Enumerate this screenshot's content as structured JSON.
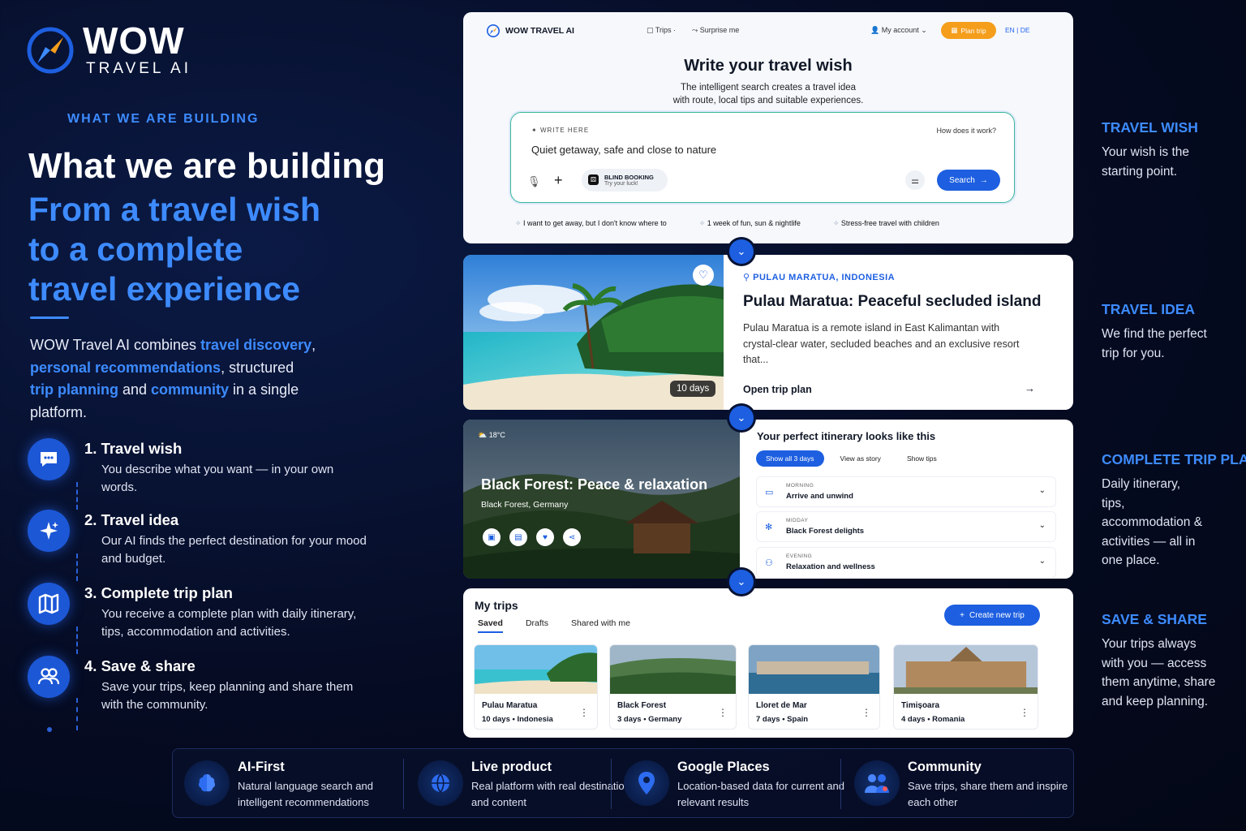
{
  "brand": {
    "name": "WOW",
    "tagline": "TRAVEL AI"
  },
  "left": {
    "eyebrow": "WHAT WE ARE BUILDING",
    "heading": "What we are building",
    "subheading_lines": [
      "From a travel wish",
      "to a complete",
      "travel experience"
    ],
    "intro": {
      "p1": "WOW Travel AI combines ",
      "k1": "travel discovery",
      "p2": ",",
      "k2": "personal recommendations",
      "p3": ", structured",
      "k3": "trip planning",
      "p4": " and ",
      "k4": "community",
      "p5": " in a single platform."
    },
    "steps": [
      {
        "title": "1.  Travel wish",
        "desc": "You describe what you want — in your own words.",
        "icon": "chat-icon"
      },
      {
        "title": "2.  Travel idea",
        "desc": "Our AI finds the perfect destination for your mood and budget.",
        "icon": "sparkle-icon"
      },
      {
        "title": "3.  Complete trip plan",
        "desc": "You receive a complete plan with daily itinerary, tips, accommodation and activities.",
        "icon": "map-icon"
      },
      {
        "title": "4.  Save & share",
        "desc": "Save your trips, keep planning and share them with the community.",
        "icon": "people-icon"
      }
    ]
  },
  "side": [
    {
      "title": "TRAVEL WISH",
      "desc": "Your wish is the starting point."
    },
    {
      "title": "TRAVEL IDEA",
      "desc": "We find the perfect trip for you."
    },
    {
      "title": "COMPLETE TRIP PLAN",
      "desc": "Daily itinerary, tips, accommodation & activities — all in one place."
    },
    {
      "title": "SAVE & SHARE",
      "desc": "Your trips always with you — access them anytime, share and keep planning."
    }
  ],
  "search_card": {
    "nav": {
      "brand": "WOW TRAVEL AI",
      "trips": "Trips",
      "surprise": "Surprise me",
      "account": "My account",
      "plan": "Plan trip",
      "lang": "EN  |  DE"
    },
    "title": "Write your travel wish",
    "subtitle_1": "The intelligent search creates a travel idea",
    "subtitle_2": "with route, local tips and suitable experiences.",
    "label": "WRITE HERE",
    "how": "How does it work?",
    "query": "Quiet getaway, safe and close to nature",
    "blind_title": "BLIND BOOKING",
    "blind_sub": "Try your luck!",
    "search_label": "Search",
    "chips": [
      "I want to get away, but I don't know where to",
      "1 week of fun, sun & nightlife",
      "Stress-free travel with children"
    ]
  },
  "idea_card": {
    "location": "PULAU MARATUA, INDONESIA",
    "title": "Pulau Maratua: Peaceful secluded island",
    "desc": "Pulau Maratua is a remote island in East Kalimantan with crystal-clear water, secluded beaches and an exclusive resort that...",
    "days": "10 days",
    "open": "Open trip plan"
  },
  "plan_card": {
    "temp": "18°C",
    "title": "Black Forest: Peace & relaxation",
    "subtitle": "Black Forest, Germany",
    "heading": "Your perfect itinerary looks like this",
    "tabs": [
      "Show all 3 days",
      "View as story",
      "Show tips"
    ],
    "slots": [
      {
        "time": "MORNING",
        "title": "Arrive and unwind"
      },
      {
        "time": "MIDDAY",
        "title": "Black Forest delights"
      },
      {
        "time": "EVENING",
        "title": "Relaxation and wellness"
      }
    ]
  },
  "trips_card": {
    "title": "My trips",
    "tabs": [
      "Saved",
      "Drafts",
      "Shared with me"
    ],
    "create": "Create new trip",
    "trips": [
      {
        "name": "Pulau Maratua",
        "meta": "10 days • Indonesia"
      },
      {
        "name": "Black Forest",
        "meta": "3 days • Germany"
      },
      {
        "name": "Lloret de Mar",
        "meta": "7 days • Spain"
      },
      {
        "name": "Timișoara",
        "meta": "4 days • Romania"
      }
    ]
  },
  "features": [
    {
      "title": "AI-First",
      "desc": "Natural language search and intelligent recommendations",
      "icon": "brain-icon"
    },
    {
      "title": "Live product",
      "desc": "Real platform with real destinations and content",
      "icon": "globe-icon"
    },
    {
      "title": "Google Places",
      "desc": "Location-based data for current and relevant results",
      "icon": "location-pin-icon"
    },
    {
      "title": "Community",
      "desc": "Save trips, share them and inspire each other",
      "icon": "community-icon"
    }
  ],
  "colors": {
    "accent": "#3d8bff",
    "primary": "#1d5fe0",
    "orange": "#f59e1c",
    "bg": "#050b22"
  }
}
